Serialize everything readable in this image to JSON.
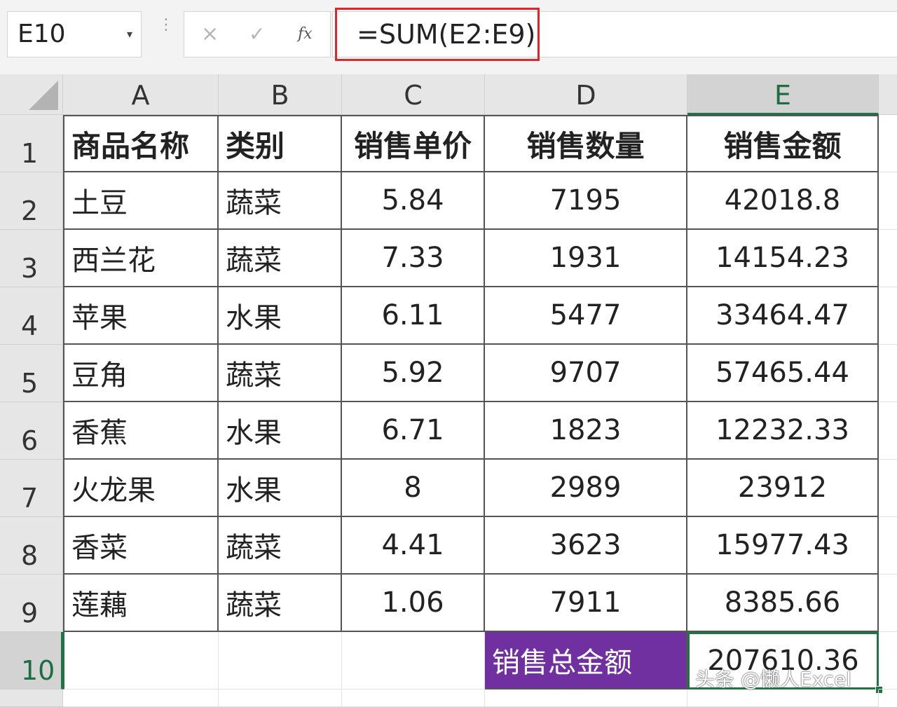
{
  "formula_bar": {
    "name_box": "E10",
    "cancel_icon": "×",
    "enter_icon": "✓",
    "fx_icon": "fx",
    "formula": "=SUM(E2:E9)"
  },
  "columns": [
    "A",
    "B",
    "C",
    "D",
    "E"
  ],
  "rows": [
    "1",
    "2",
    "3",
    "4",
    "5",
    "6",
    "7",
    "8",
    "9",
    "10"
  ],
  "table": {
    "header": [
      "商品名称",
      "类别",
      "销售单价",
      "销售数量",
      "销售金额"
    ],
    "data": [
      [
        "土豆",
        "蔬菜",
        "5.84",
        "7195",
        "42018.8"
      ],
      [
        "西兰花",
        "蔬菜",
        "7.33",
        "1931",
        "14154.23"
      ],
      [
        "苹果",
        "水果",
        "6.11",
        "5477",
        "33464.47"
      ],
      [
        "豆角",
        "蔬菜",
        "5.92",
        "9707",
        "57465.44"
      ],
      [
        "香蕉",
        "水果",
        "6.71",
        "1823",
        "12232.33"
      ],
      [
        "火龙果",
        "水果",
        "8",
        "2989",
        "23912"
      ],
      [
        "香菜",
        "蔬菜",
        "4.41",
        "3623",
        "15977.43"
      ],
      [
        "莲藕",
        "蔬菜",
        "1.06",
        "7911",
        "8385.66"
      ]
    ],
    "total_label": "销售总金额",
    "total_value": "207610.36"
  },
  "watermark": "头条 @懒人Excel",
  "colors": {
    "accent": "#217346",
    "highlight_border": "#e0262a",
    "total_label_bg": "#7030a0"
  }
}
